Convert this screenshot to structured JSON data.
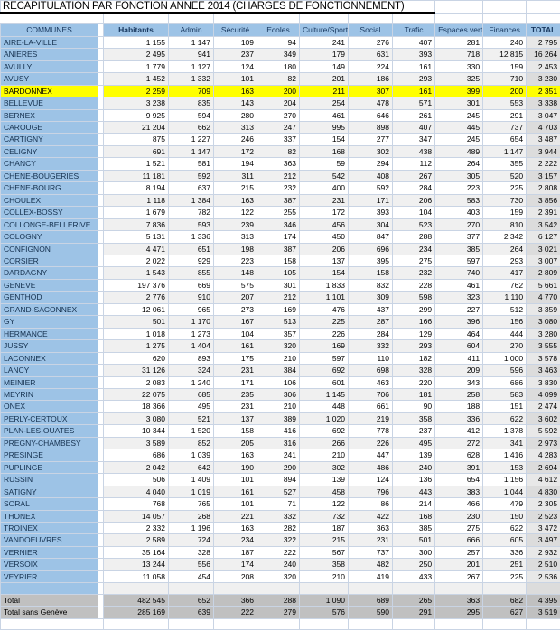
{
  "document": {
    "title": "RECAPITULATION PAR FONCTION ANNEE 2014 (CHARGES DE FONCTIONNEMENT)"
  },
  "table": {
    "columns": [
      "COMMUNES",
      "Habitants",
      "Admin",
      "Sécurité",
      "Ecoles",
      "Culture/Sports",
      "Social",
      "Trafic",
      "Espaces verts",
      "Finances",
      "TOTAL"
    ],
    "highlight_row": "BARDONNEX",
    "highlight_color": "#ffff00",
    "header_color": "#9dc3e6",
    "total_color": "#c0c0c0",
    "rows": [
      {
        "commune": "AIRE-LA-VILLE",
        "habitants": "1 155",
        "values": [
          "1 147",
          "109",
          "94",
          "241",
          "276",
          "407",
          "281",
          "240",
          "2 795"
        ]
      },
      {
        "commune": "ANIERES",
        "habitants": "2 495",
        "values": [
          "941",
          "237",
          "349",
          "179",
          "631",
          "393",
          "718",
          "12 815",
          "16 264"
        ]
      },
      {
        "commune": "AVULLY",
        "habitants": "1 779",
        "values": [
          "1 127",
          "124",
          "180",
          "149",
          "224",
          "161",
          "330",
          "159",
          "2 453"
        ]
      },
      {
        "commune": "AVUSY",
        "habitants": "1 452",
        "values": [
          "1 332",
          "101",
          "82",
          "201",
          "186",
          "293",
          "325",
          "710",
          "3 230"
        ]
      },
      {
        "commune": "BARDONNEX",
        "habitants": "2 259",
        "values": [
          "709",
          "163",
          "200",
          "211",
          "307",
          "161",
          "399",
          "200",
          "2 351"
        ]
      },
      {
        "commune": "BELLEVUE",
        "habitants": "3 238",
        "values": [
          "835",
          "143",
          "204",
          "254",
          "478",
          "571",
          "301",
          "553",
          "3 338"
        ]
      },
      {
        "commune": "BERNEX",
        "habitants": "9 925",
        "values": [
          "594",
          "280",
          "270",
          "461",
          "646",
          "261",
          "245",
          "291",
          "3 047"
        ]
      },
      {
        "commune": "CAROUGE",
        "habitants": "21 204",
        "values": [
          "662",
          "313",
          "247",
          "995",
          "898",
          "407",
          "445",
          "737",
          "4 703"
        ]
      },
      {
        "commune": "CARTIGNY",
        "habitants": "875",
        "values": [
          "1 227",
          "246",
          "337",
          "154",
          "277",
          "347",
          "245",
          "654",
          "3 487"
        ]
      },
      {
        "commune": "CELIGNY",
        "habitants": "691",
        "values": [
          "1 147",
          "172",
          "82",
          "168",
          "302",
          "438",
          "489",
          "1 147",
          "3 944"
        ]
      },
      {
        "commune": "CHANCY",
        "habitants": "1 521",
        "values": [
          "581",
          "194",
          "363",
          "59",
          "294",
          "112",
          "264",
          "355",
          "2 222"
        ]
      },
      {
        "commune": "CHENE-BOUGERIES",
        "habitants": "11 181",
        "values": [
          "592",
          "311",
          "212",
          "542",
          "408",
          "267",
          "305",
          "520",
          "3 157"
        ]
      },
      {
        "commune": "CHENE-BOURG",
        "habitants": "8 194",
        "values": [
          "637",
          "215",
          "232",
          "400",
          "592",
          "284",
          "223",
          "225",
          "2 808"
        ]
      },
      {
        "commune": "CHOULEX",
        "habitants": "1 118",
        "values": [
          "1 384",
          "163",
          "387",
          "231",
          "171",
          "206",
          "583",
          "730",
          "3 856"
        ]
      },
      {
        "commune": "COLLEX-BOSSY",
        "habitants": "1 679",
        "values": [
          "782",
          "122",
          "255",
          "172",
          "393",
          "104",
          "403",
          "159",
          "2 391"
        ]
      },
      {
        "commune": "COLLONGE-BELLERIVE",
        "habitants": "7 836",
        "values": [
          "593",
          "239",
          "346",
          "456",
          "304",
          "523",
          "270",
          "810",
          "3 542"
        ]
      },
      {
        "commune": "COLOGNY",
        "habitants": "5 131",
        "values": [
          "1 336",
          "313",
          "174",
          "450",
          "847",
          "288",
          "377",
          "2 342",
          "6 127"
        ]
      },
      {
        "commune": "CONFIGNON",
        "habitants": "4 471",
        "values": [
          "651",
          "198",
          "387",
          "206",
          "696",
          "234",
          "385",
          "264",
          "3 021"
        ]
      },
      {
        "commune": "CORSIER",
        "habitants": "2 022",
        "values": [
          "929",
          "223",
          "158",
          "137",
          "395",
          "275",
          "597",
          "293",
          "3 007"
        ]
      },
      {
        "commune": "DARDAGNY",
        "habitants": "1 543",
        "values": [
          "855",
          "148",
          "105",
          "154",
          "158",
          "232",
          "740",
          "417",
          "2 809"
        ]
      },
      {
        "commune": "GENEVE",
        "habitants": "197 376",
        "values": [
          "669",
          "575",
          "301",
          "1 833",
          "832",
          "228",
          "461",
          "762",
          "5 661"
        ]
      },
      {
        "commune": "GENTHOD",
        "habitants": "2 776",
        "values": [
          "910",
          "207",
          "212",
          "1 101",
          "309",
          "598",
          "323",
          "1 110",
          "4 770"
        ]
      },
      {
        "commune": "GRAND-SACONNEX",
        "habitants": "12 061",
        "values": [
          "965",
          "273",
          "169",
          "476",
          "437",
          "299",
          "227",
          "512",
          "3 359"
        ]
      },
      {
        "commune": "GY",
        "habitants": "501",
        "values": [
          "1 170",
          "167",
          "513",
          "225",
          "287",
          "166",
          "396",
          "156",
          "3 080"
        ]
      },
      {
        "commune": "HERMANCE",
        "habitants": "1 018",
        "values": [
          "1 273",
          "104",
          "357",
          "226",
          "284",
          "129",
          "464",
          "444",
          "3 280"
        ]
      },
      {
        "commune": "JUSSY",
        "habitants": "1 275",
        "values": [
          "1 404",
          "161",
          "320",
          "169",
          "332",
          "293",
          "604",
          "270",
          "3 555"
        ]
      },
      {
        "commune": "LACONNEX",
        "habitants": "620",
        "values": [
          "893",
          "175",
          "210",
          "597",
          "110",
          "182",
          "411",
          "1 000",
          "3 578"
        ]
      },
      {
        "commune": "LANCY",
        "habitants": "31 126",
        "values": [
          "324",
          "231",
          "384",
          "692",
          "698",
          "328",
          "209",
          "596",
          "3 463"
        ]
      },
      {
        "commune": "MEINIER",
        "habitants": "2 083",
        "values": [
          "1 240",
          "171",
          "106",
          "601",
          "463",
          "220",
          "343",
          "686",
          "3 830"
        ]
      },
      {
        "commune": "MEYRIN",
        "habitants": "22 075",
        "values": [
          "685",
          "235",
          "306",
          "1 145",
          "706",
          "181",
          "258",
          "583",
          "4 099"
        ]
      },
      {
        "commune": "ONEX",
        "habitants": "18 366",
        "values": [
          "495",
          "231",
          "210",
          "448",
          "661",
          "90",
          "188",
          "151",
          "2 474"
        ]
      },
      {
        "commune": "PERLY-CERTOUX",
        "habitants": "3 080",
        "values": [
          "521",
          "137",
          "389",
          "1 020",
          "219",
          "358",
          "336",
          "622",
          "3 602"
        ]
      },
      {
        "commune": "PLAN-LES-OUATES",
        "habitants": "10 344",
        "values": [
          "1 520",
          "158",
          "416",
          "692",
          "778",
          "237",
          "412",
          "1 378",
          "5 592"
        ]
      },
      {
        "commune": "PREGNY-CHAMBESY",
        "habitants": "3 589",
        "values": [
          "852",
          "205",
          "316",
          "266",
          "226",
          "495",
          "272",
          "341",
          "2 973"
        ]
      },
      {
        "commune": "PRESINGE",
        "habitants": "686",
        "values": [
          "1 039",
          "163",
          "241",
          "210",
          "447",
          "139",
          "628",
          "1 416",
          "4 283"
        ]
      },
      {
        "commune": "PUPLINGE",
        "habitants": "2 042",
        "values": [
          "642",
          "190",
          "290",
          "302",
          "486",
          "240",
          "391",
          "153",
          "2 694"
        ]
      },
      {
        "commune": "RUSSIN",
        "habitants": "506",
        "values": [
          "1 409",
          "101",
          "894",
          "139",
          "124",
          "136",
          "654",
          "1 156",
          "4 612"
        ]
      },
      {
        "commune": "SATIGNY",
        "habitants": "4 040",
        "values": [
          "1 019",
          "161",
          "527",
          "458",
          "796",
          "443",
          "383",
          "1 044",
          "4 830"
        ]
      },
      {
        "commune": "SORAL",
        "habitants": "768",
        "values": [
          "765",
          "101",
          "71",
          "122",
          "86",
          "214",
          "466",
          "479",
          "2 305"
        ]
      },
      {
        "commune": "THONEX",
        "habitants": "14 057",
        "values": [
          "268",
          "221",
          "332",
          "732",
          "422",
          "168",
          "230",
          "150",
          "2 523"
        ]
      },
      {
        "commune": "TROINEX",
        "habitants": "2 332",
        "values": [
          "1 196",
          "163",
          "282",
          "187",
          "363",
          "385",
          "275",
          "622",
          "3 472"
        ]
      },
      {
        "commune": "VANDOEUVRES",
        "habitants": "2 589",
        "values": [
          "724",
          "234",
          "322",
          "215",
          "231",
          "501",
          "666",
          "605",
          "3 497"
        ]
      },
      {
        "commune": "VERNIER",
        "habitants": "35 164",
        "values": [
          "328",
          "187",
          "222",
          "567",
          "737",
          "300",
          "257",
          "336",
          "2 932"
        ]
      },
      {
        "commune": "VERSOIX",
        "habitants": "13 244",
        "values": [
          "556",
          "174",
          "240",
          "358",
          "482",
          "250",
          "201",
          "251",
          "2 510"
        ]
      },
      {
        "commune": "VEYRIER",
        "habitants": "11 058",
        "values": [
          "454",
          "208",
          "320",
          "210",
          "419",
          "433",
          "267",
          "225",
          "2 536"
        ]
      }
    ],
    "totals": [
      {
        "label": "Total",
        "habitants": "482 545",
        "values": [
          "652",
          "366",
          "288",
          "1 090",
          "689",
          "265",
          "363",
          "682",
          "4 395"
        ]
      },
      {
        "label": "Total sans Genève",
        "habitants": "285 169",
        "values": [
          "639",
          "222",
          "279",
          "576",
          "590",
          "291",
          "295",
          "627",
          "3 519"
        ]
      }
    ]
  }
}
